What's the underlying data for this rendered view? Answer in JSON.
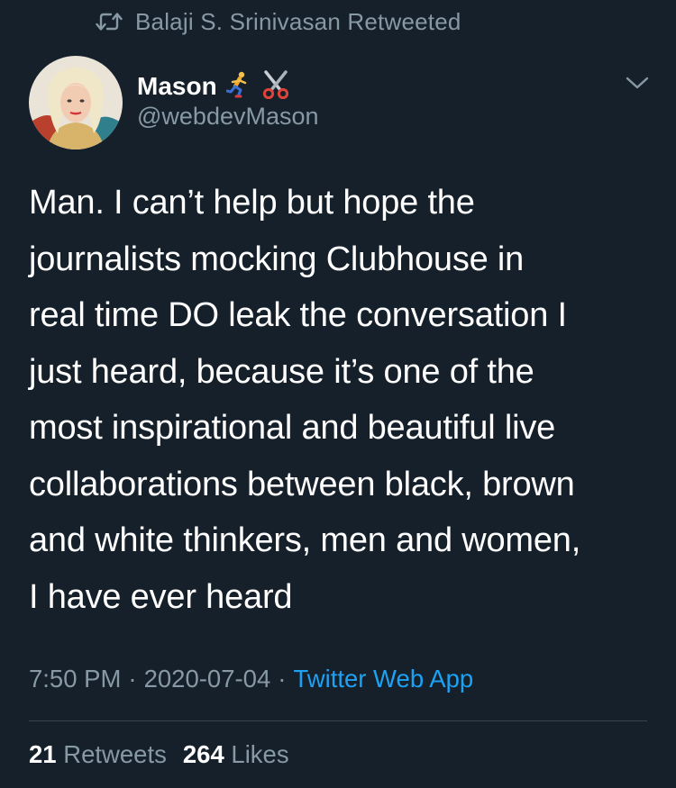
{
  "retweet": {
    "icon": "retweet-icon",
    "label": "Balaji S. Srinivasan Retweeted"
  },
  "author": {
    "display_name": "Mason",
    "name_emojis": [
      "runner-emoji",
      "scissors-emoji"
    ],
    "handle": "@webdevMason",
    "avatar": "avatar-photo"
  },
  "tweet": {
    "lines": [
      "Man. I can’t help but hope the",
      "journalists mocking Clubhouse in",
      "real time DO leak the conversation I",
      "just heard, because it’s one of the",
      "most inspirational and beautiful live",
      "collaborations between black, brown",
      "and white thinkers, men and women,",
      "I have ever heard"
    ]
  },
  "meta": {
    "time": "7:50 PM",
    "separator": "·",
    "date": "2020-07-04",
    "source": "Twitter Web App"
  },
  "stats": {
    "retweets_count": "21",
    "retweets_label": "Retweets",
    "likes_count": "264",
    "likes_label": "Likes"
  },
  "colors": {
    "background": "#15202b",
    "primary_text": "#ffffff",
    "secondary_text": "#8899a6",
    "link": "#1da1f2",
    "divider": "#38444d"
  },
  "menu": {
    "icon": "chevron-down-icon"
  }
}
